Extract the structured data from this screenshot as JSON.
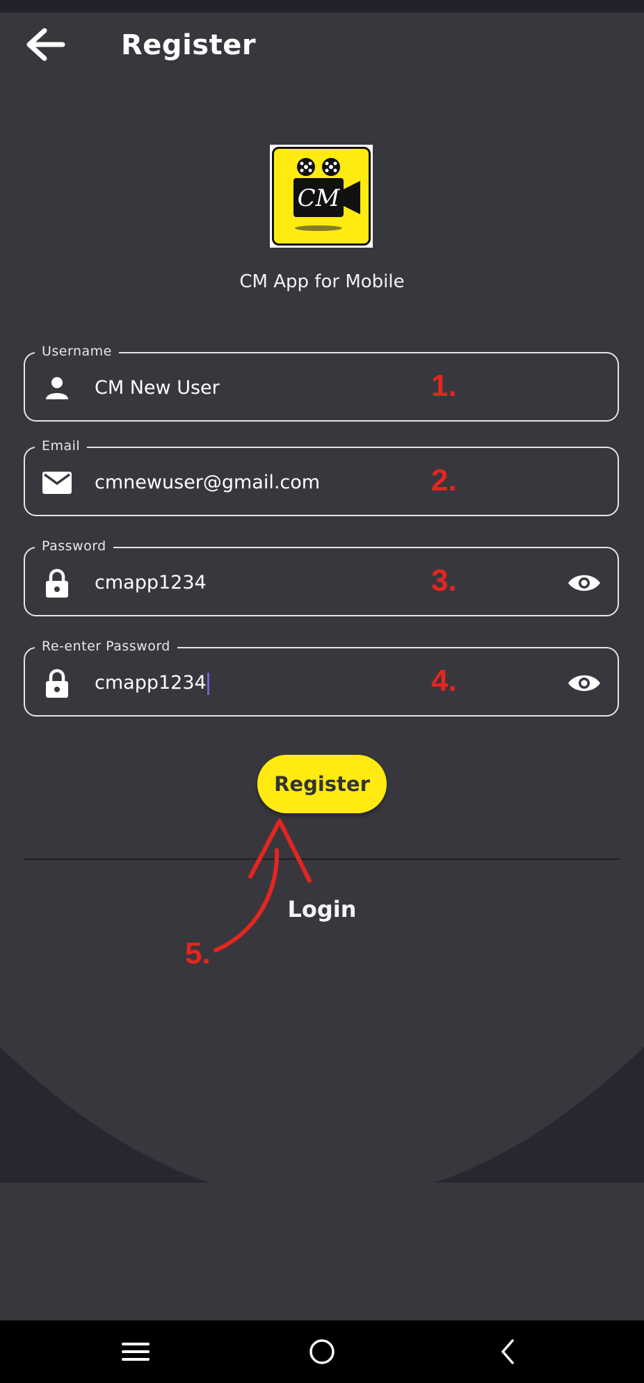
{
  "appbar": {
    "title": "Register"
  },
  "app": {
    "caption": "CM App for Mobile",
    "logo_text": "CM"
  },
  "form": {
    "username": {
      "label": "Username",
      "value": "CM New User",
      "marker": "1."
    },
    "email": {
      "label": "Email",
      "value": "cmnewuser@gmail.com",
      "marker": "2."
    },
    "password": {
      "label": "Password",
      "value": "cmapp1234",
      "marker": "3."
    },
    "reenter_password": {
      "label": "Re-enter Password",
      "value": "cmapp1234",
      "marker": "4."
    }
  },
  "actions": {
    "register_label": "Register",
    "login_label": "Login",
    "annotation_marker": "5."
  },
  "icons": {
    "back": "arrow-left-icon",
    "user": "person-icon",
    "email": "envelope-icon",
    "lock": "lock-icon",
    "visibility": "eye-icon",
    "nav_recent": "menu-lines-icon",
    "nav_home": "circle-home-icon",
    "nav_back": "chevron-left-icon"
  },
  "colors": {
    "accent": "#ffea12",
    "background": "#38373d",
    "annotation": "#e3261f",
    "navbar": "#000000"
  }
}
